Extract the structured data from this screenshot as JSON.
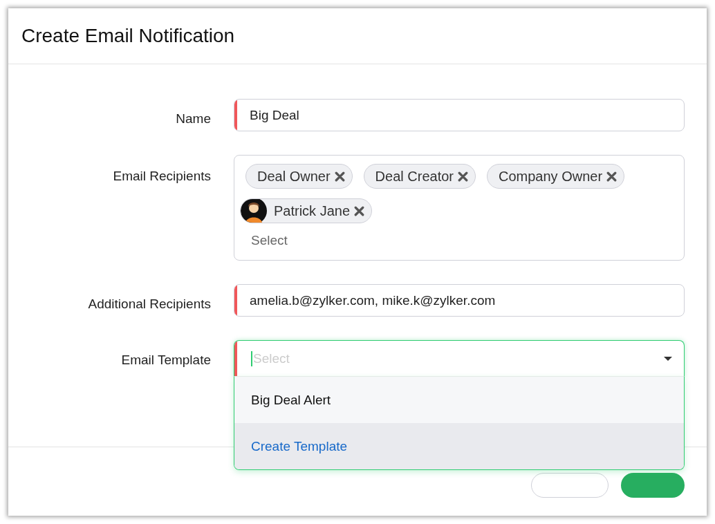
{
  "dialog": {
    "title": "Create Email Notification"
  },
  "fields": [
    {
      "label": "Name",
      "kind": "text",
      "required": true,
      "value": "Big Deal"
    },
    {
      "label": "Email Recipients",
      "kind": "chips",
      "required": false,
      "placeholder": "Select",
      "chips": [
        {
          "label": "Deal Owner",
          "kind": "role"
        },
        {
          "label": "Deal Creator",
          "kind": "role"
        },
        {
          "label": "Company Owner",
          "kind": "role"
        },
        {
          "label": "Patrick Jane",
          "kind": "user"
        }
      ]
    },
    {
      "label": "Additional Recipients",
      "kind": "text",
      "required": true,
      "value": "amelia.b@zylker.com, mike.k@zylker.com"
    },
    {
      "label": "Email Template",
      "kind": "select",
      "required": true,
      "focused": true,
      "expanded": true,
      "placeholder": "Select",
      "options": [
        {
          "label": "Big Deal Alert",
          "kind": "option",
          "selected": false
        },
        {
          "label": "Create Template",
          "kind": "action",
          "selected": true
        }
      ]
    }
  ]
}
